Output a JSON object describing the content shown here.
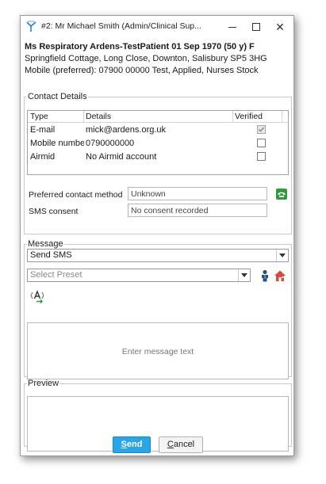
{
  "window": {
    "title": "#2: Mr Michael Smith (Admin/Clinical Sup...",
    "minimize_glyph": "",
    "maximize_glyph": "",
    "close_glyph": "✕"
  },
  "patient": {
    "name_line": "Ms Respiratory Ardens-TestPatient 01 Sep 1970 (50 y) F",
    "address": "Springfield Cottage, Long Close, Downton, Salisbury SP5 3HG",
    "mobile": "Mobile (preferred): 07900 00000   Test, Applied, Nurses Stock"
  },
  "contact_details": {
    "legend": "Contact Details",
    "columns": [
      "Type",
      "Details",
      "Verified"
    ],
    "rows": [
      {
        "type": "E-mail",
        "details": "mick@ardens.org.uk",
        "verified": true
      },
      {
        "type": "Mobile numbe",
        "details": "0790000000",
        "verified": false
      },
      {
        "type": "Airmid",
        "details": "No Airmid account",
        "verified": false
      }
    ],
    "preferred_label": "Preferred contact method",
    "preferred_value": "Unknown",
    "sms_consent_label": "SMS consent",
    "sms_consent_value": "No consent recorded"
  },
  "message": {
    "legend": "Message",
    "type_value": "Send SMS",
    "preset_placeholder": "Select Preset",
    "text_placeholder": "Enter message text"
  },
  "preview": {
    "legend": "Preview"
  },
  "buttons": {
    "send_accel": "S",
    "send_rest": "end",
    "cancel_accel": "C",
    "cancel_rest": "ancel"
  },
  "colors": {
    "send_button": "#2aa5e8",
    "phone_icon": "#2e9d3a"
  }
}
